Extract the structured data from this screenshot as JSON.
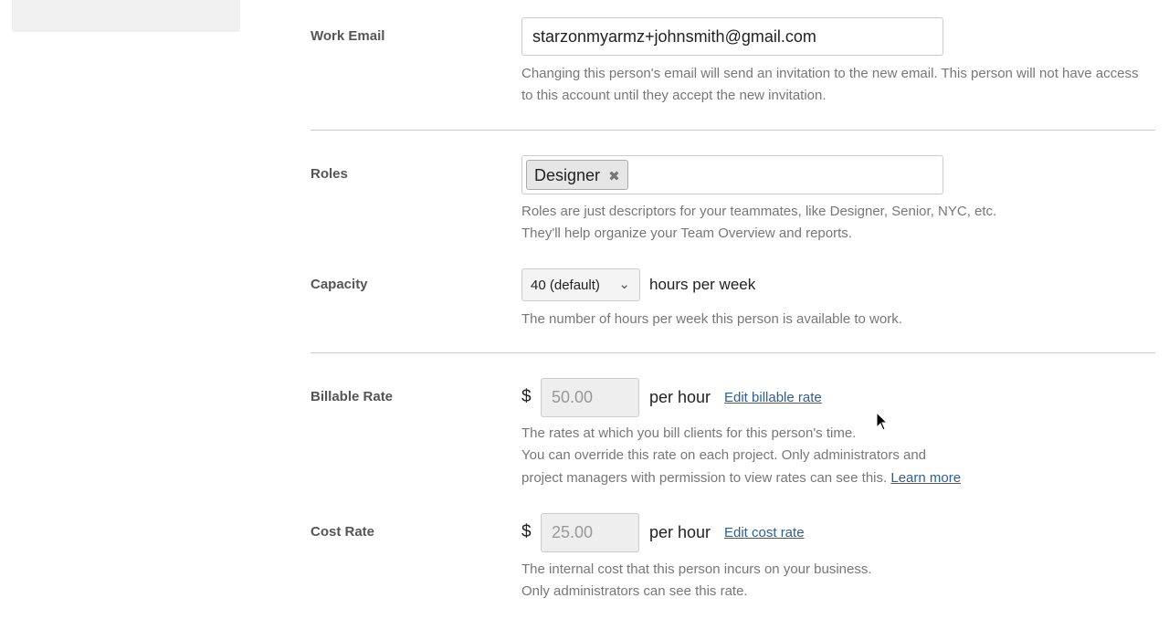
{
  "work_email": {
    "label": "Work Email",
    "value": "starzonmyarmz+johnsmith@gmail.com",
    "help": "Changing this person's email will send an invitation to the new email. This person will not have access to this account until they accept the new invitation."
  },
  "roles": {
    "label": "Roles",
    "tags": [
      "Designer"
    ],
    "help_1": "Roles are just descriptors for your teammates, like Designer, Senior, NYC, etc.",
    "help_2": "They'll help organize your Team Overview and reports."
  },
  "capacity": {
    "label": "Capacity",
    "selected": "40 (default)",
    "unit": "hours per week",
    "help": "The number of hours per week this person is available to work."
  },
  "billable": {
    "label": "Billable Rate",
    "currency": "$",
    "value": "50.00",
    "unit": "per hour",
    "edit_link": "Edit billable rate",
    "help_1": "The rates at which you bill clients for this person's time.",
    "help_2": "You can override this rate on each project. Only administrators and",
    "help_3": "project managers with permission to view rates can see this.",
    "learn_more": "Learn more"
  },
  "cost": {
    "label": "Cost Rate",
    "currency": "$",
    "value": "25.00",
    "unit": "per hour",
    "edit_link": "Edit cost rate",
    "help_1": "The internal cost that this person incurs on your business.",
    "help_2": "Only administrators can see this rate."
  }
}
